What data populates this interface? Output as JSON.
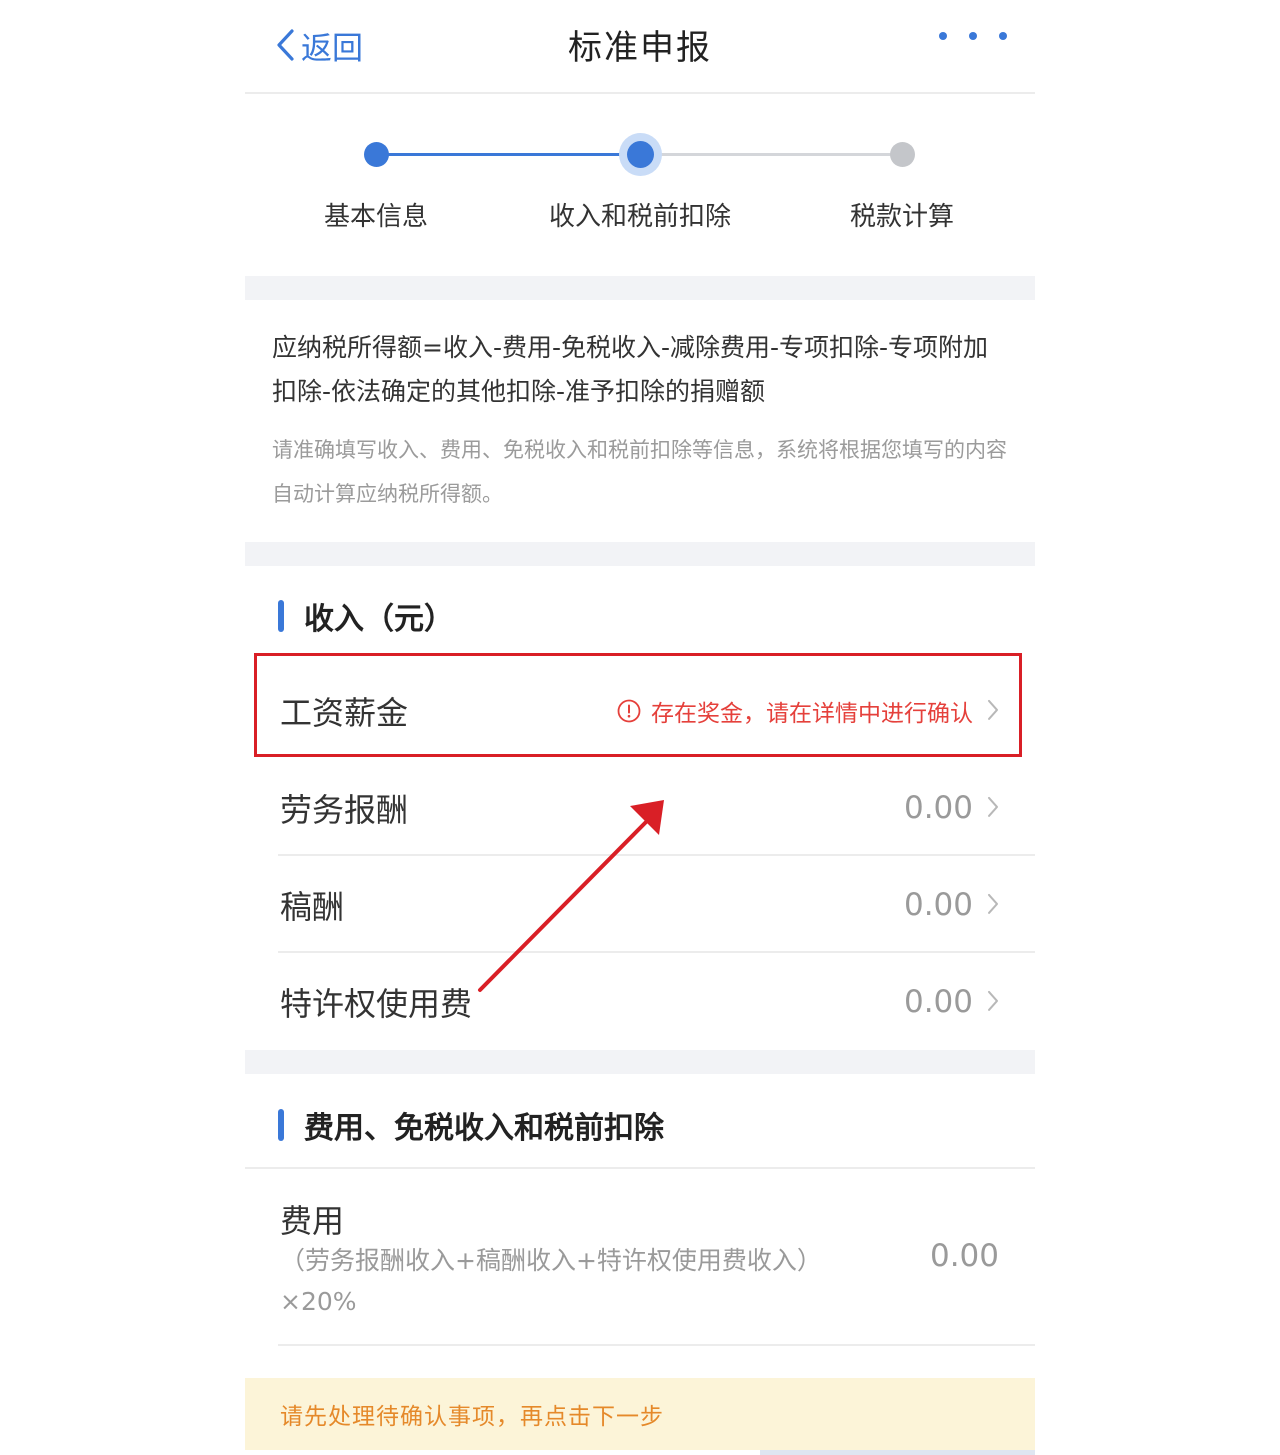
{
  "header": {
    "back_label": "返回",
    "title": "标准申报"
  },
  "steps": [
    {
      "label": "基本信息",
      "state": "done"
    },
    {
      "label": "收入和税前扣除",
      "state": "current"
    },
    {
      "label": "税款计算",
      "state": "pending"
    }
  ],
  "formula": {
    "text": "应纳税所得额=收入-费用-免税收入-减除费用-专项扣除-专项附加扣除-依法确定的其他扣除-准予扣除的捐赠额",
    "note": "请准确填写收入、费用、免税收入和税前扣除等信息，系统将根据您填写的内容自动计算应纳税所得额。"
  },
  "income_section": {
    "title": "收入（元）",
    "rows": [
      {
        "label": "工资薪金",
        "warning": "存在奖金，请在详情中进行确认"
      },
      {
        "label": "劳务报酬",
        "value": "0.00"
      },
      {
        "label": "稿酬",
        "value": "0.00"
      },
      {
        "label": "特许权使用费",
        "value": "0.00"
      }
    ]
  },
  "deduction_section": {
    "title": "费用、免税收入和税前扣除",
    "expense": {
      "label": "费用",
      "note": "（劳务报酬收入+稿酬收入+特许权使用费收入）×20%",
      "value": "0.00"
    }
  },
  "banner": {
    "text": "请先处理待确认事项，再点击下一步"
  },
  "colors": {
    "accent": "#3a78d8",
    "warning": "#e5403b",
    "annotation": "#d91f26",
    "banner_bg": "#fcf4d8",
    "banner_text": "#e5892a"
  }
}
